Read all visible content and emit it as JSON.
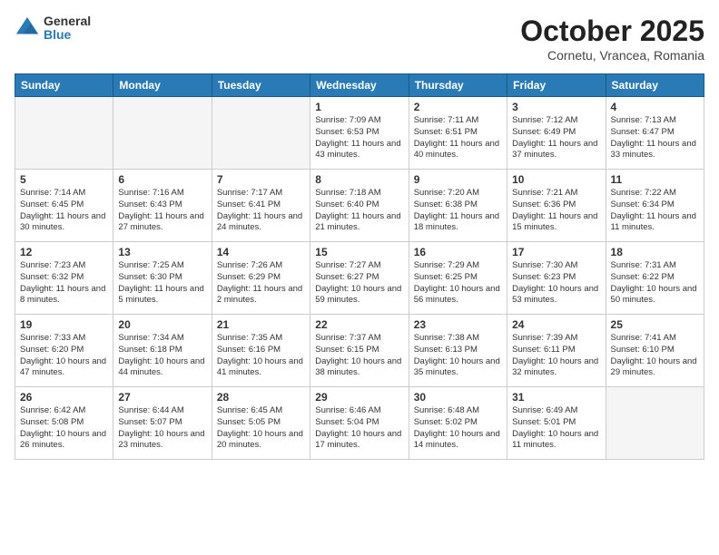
{
  "header": {
    "logo_line1": "General",
    "logo_line2": "Blue",
    "month_title": "October 2025",
    "location": "Cornetu, Vrancea, Romania"
  },
  "days_of_week": [
    "Sunday",
    "Monday",
    "Tuesday",
    "Wednesday",
    "Thursday",
    "Friday",
    "Saturday"
  ],
  "weeks": [
    [
      {
        "day": "",
        "content": ""
      },
      {
        "day": "",
        "content": ""
      },
      {
        "day": "",
        "content": ""
      },
      {
        "day": "1",
        "content": "Sunrise: 7:09 AM\nSunset: 6:53 PM\nDaylight: 11 hours and 43 minutes."
      },
      {
        "day": "2",
        "content": "Sunrise: 7:11 AM\nSunset: 6:51 PM\nDaylight: 11 hours and 40 minutes."
      },
      {
        "day": "3",
        "content": "Sunrise: 7:12 AM\nSunset: 6:49 PM\nDaylight: 11 hours and 37 minutes."
      },
      {
        "day": "4",
        "content": "Sunrise: 7:13 AM\nSunset: 6:47 PM\nDaylight: 11 hours and 33 minutes."
      }
    ],
    [
      {
        "day": "5",
        "content": "Sunrise: 7:14 AM\nSunset: 6:45 PM\nDaylight: 11 hours and 30 minutes."
      },
      {
        "day": "6",
        "content": "Sunrise: 7:16 AM\nSunset: 6:43 PM\nDaylight: 11 hours and 27 minutes."
      },
      {
        "day": "7",
        "content": "Sunrise: 7:17 AM\nSunset: 6:41 PM\nDaylight: 11 hours and 24 minutes."
      },
      {
        "day": "8",
        "content": "Sunrise: 7:18 AM\nSunset: 6:40 PM\nDaylight: 11 hours and 21 minutes."
      },
      {
        "day": "9",
        "content": "Sunrise: 7:20 AM\nSunset: 6:38 PM\nDaylight: 11 hours and 18 minutes."
      },
      {
        "day": "10",
        "content": "Sunrise: 7:21 AM\nSunset: 6:36 PM\nDaylight: 11 hours and 15 minutes."
      },
      {
        "day": "11",
        "content": "Sunrise: 7:22 AM\nSunset: 6:34 PM\nDaylight: 11 hours and 11 minutes."
      }
    ],
    [
      {
        "day": "12",
        "content": "Sunrise: 7:23 AM\nSunset: 6:32 PM\nDaylight: 11 hours and 8 minutes."
      },
      {
        "day": "13",
        "content": "Sunrise: 7:25 AM\nSunset: 6:30 PM\nDaylight: 11 hours and 5 minutes."
      },
      {
        "day": "14",
        "content": "Sunrise: 7:26 AM\nSunset: 6:29 PM\nDaylight: 11 hours and 2 minutes."
      },
      {
        "day": "15",
        "content": "Sunrise: 7:27 AM\nSunset: 6:27 PM\nDaylight: 10 hours and 59 minutes."
      },
      {
        "day": "16",
        "content": "Sunrise: 7:29 AM\nSunset: 6:25 PM\nDaylight: 10 hours and 56 minutes."
      },
      {
        "day": "17",
        "content": "Sunrise: 7:30 AM\nSunset: 6:23 PM\nDaylight: 10 hours and 53 minutes."
      },
      {
        "day": "18",
        "content": "Sunrise: 7:31 AM\nSunset: 6:22 PM\nDaylight: 10 hours and 50 minutes."
      }
    ],
    [
      {
        "day": "19",
        "content": "Sunrise: 7:33 AM\nSunset: 6:20 PM\nDaylight: 10 hours and 47 minutes."
      },
      {
        "day": "20",
        "content": "Sunrise: 7:34 AM\nSunset: 6:18 PM\nDaylight: 10 hours and 44 minutes."
      },
      {
        "day": "21",
        "content": "Sunrise: 7:35 AM\nSunset: 6:16 PM\nDaylight: 10 hours and 41 minutes."
      },
      {
        "day": "22",
        "content": "Sunrise: 7:37 AM\nSunset: 6:15 PM\nDaylight: 10 hours and 38 minutes."
      },
      {
        "day": "23",
        "content": "Sunrise: 7:38 AM\nSunset: 6:13 PM\nDaylight: 10 hours and 35 minutes."
      },
      {
        "day": "24",
        "content": "Sunrise: 7:39 AM\nSunset: 6:11 PM\nDaylight: 10 hours and 32 minutes."
      },
      {
        "day": "25",
        "content": "Sunrise: 7:41 AM\nSunset: 6:10 PM\nDaylight: 10 hours and 29 minutes."
      }
    ],
    [
      {
        "day": "26",
        "content": "Sunrise: 6:42 AM\nSunset: 5:08 PM\nDaylight: 10 hours and 26 minutes."
      },
      {
        "day": "27",
        "content": "Sunrise: 6:44 AM\nSunset: 5:07 PM\nDaylight: 10 hours and 23 minutes."
      },
      {
        "day": "28",
        "content": "Sunrise: 6:45 AM\nSunset: 5:05 PM\nDaylight: 10 hours and 20 minutes."
      },
      {
        "day": "29",
        "content": "Sunrise: 6:46 AM\nSunset: 5:04 PM\nDaylight: 10 hours and 17 minutes."
      },
      {
        "day": "30",
        "content": "Sunrise: 6:48 AM\nSunset: 5:02 PM\nDaylight: 10 hours and 14 minutes."
      },
      {
        "day": "31",
        "content": "Sunrise: 6:49 AM\nSunset: 5:01 PM\nDaylight: 10 hours and 11 minutes."
      },
      {
        "day": "",
        "content": ""
      }
    ]
  ]
}
